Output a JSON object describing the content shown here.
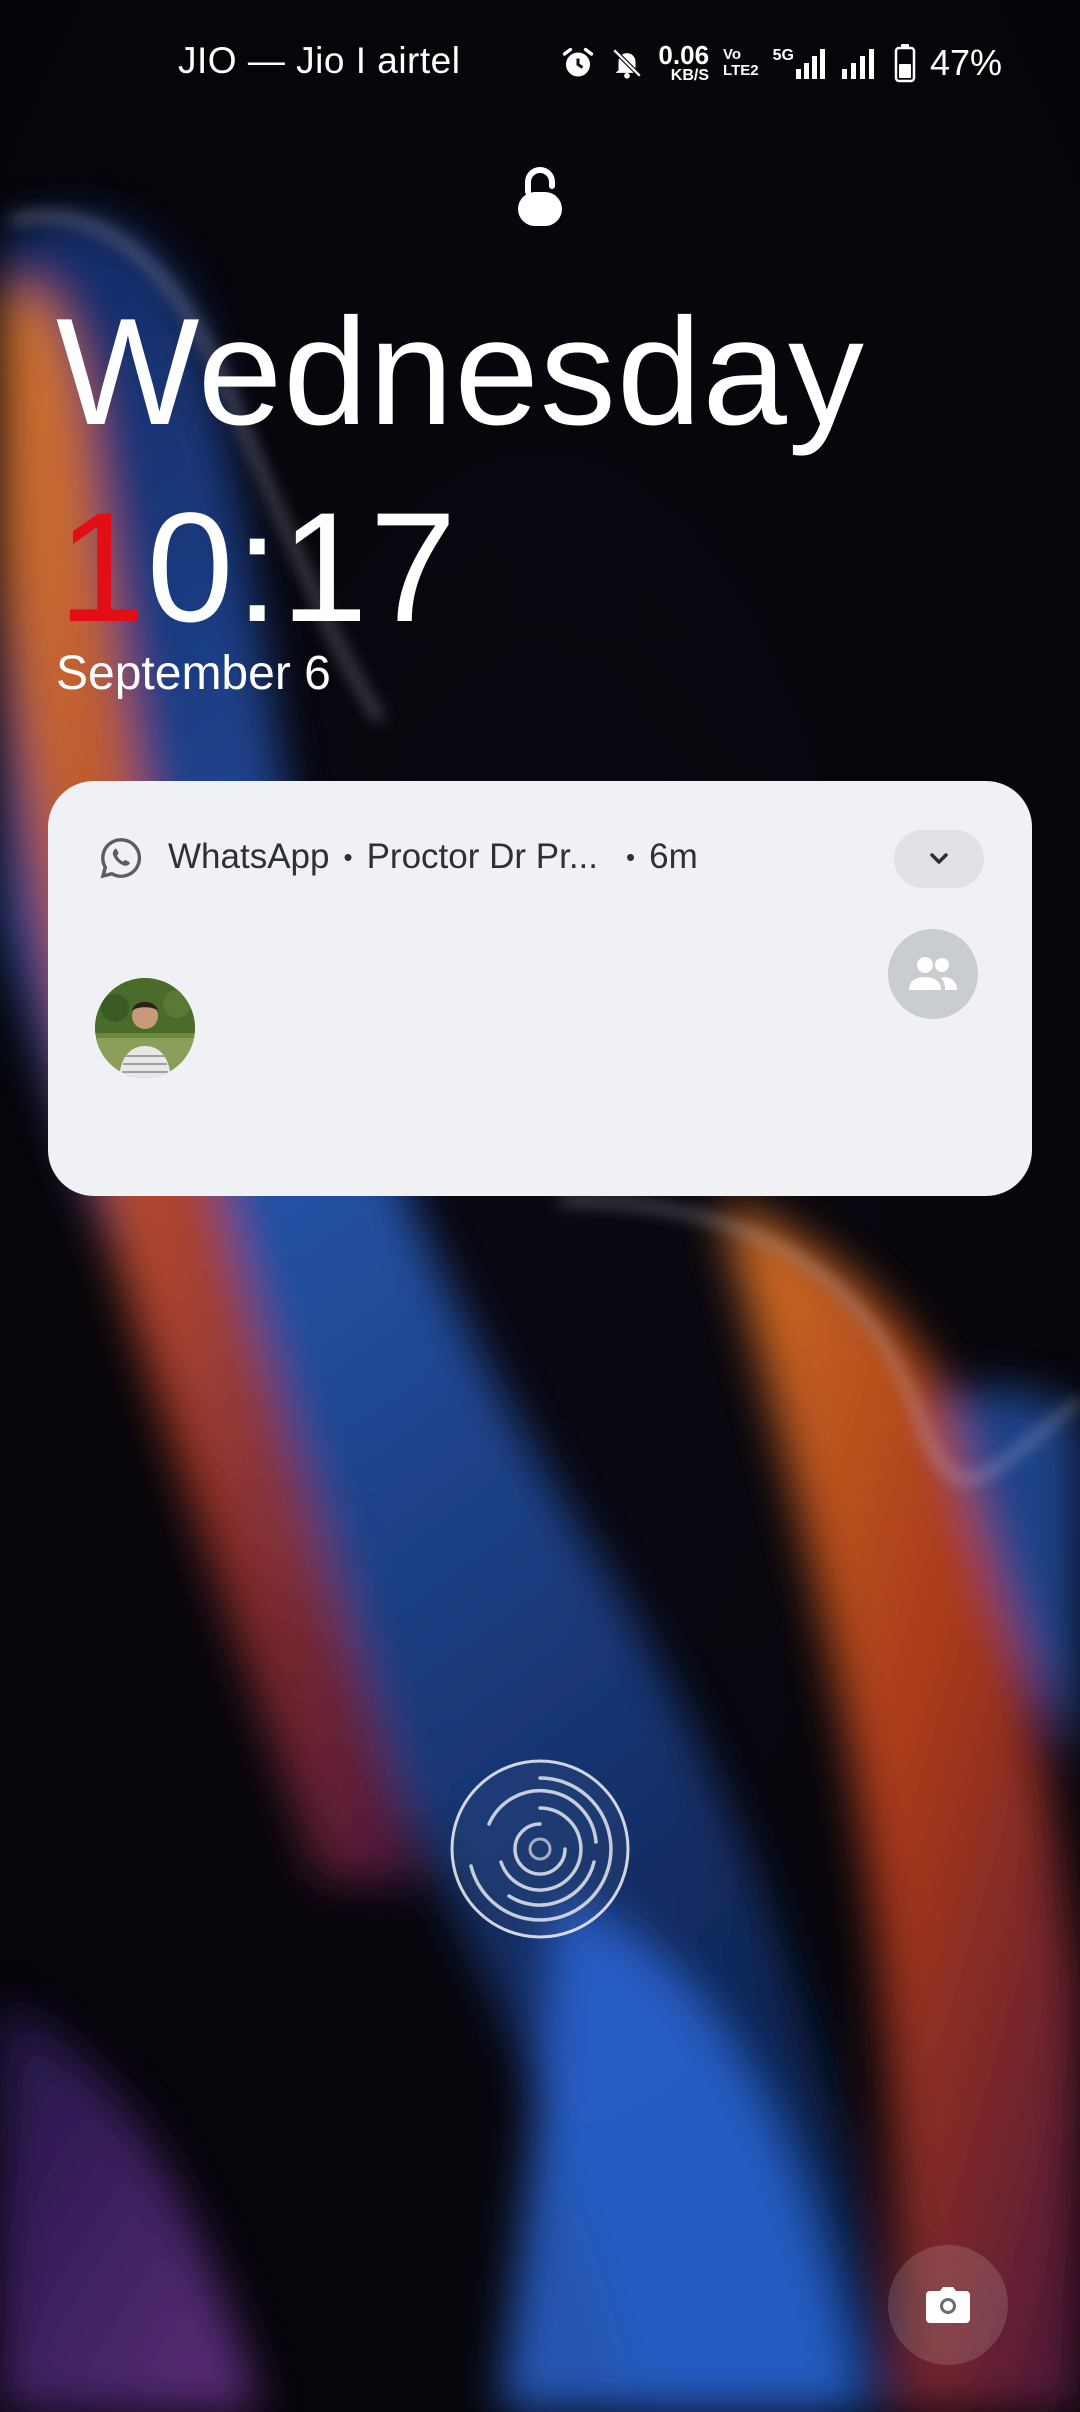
{
  "status_bar": {
    "carrier": "JIO — Jio I airtel",
    "speed_value": "0.06",
    "speed_unit": "KB/S",
    "volte_top": "Vo",
    "volte_bottom": "LTE2",
    "network_type": "5G",
    "battery_percent": "47%",
    "icons": [
      "alarm-icon",
      "bell-off-icon",
      "signal-icon",
      "battery-icon"
    ]
  },
  "lockscreen": {
    "day": "Wednesday",
    "time_accent": "1",
    "time_rest": "0:17",
    "date": "September 6",
    "accent_color": "#e10f15"
  },
  "notification": {
    "app_name": "WhatsApp",
    "title": "Proctor Dr Pr...",
    "time_ago": "6m",
    "icons": [
      "whatsapp-icon",
      "chevron-down-icon",
      "group-icon"
    ]
  },
  "bottom": {
    "icons": [
      "fingerprint-icon",
      "camera-icon"
    ]
  }
}
